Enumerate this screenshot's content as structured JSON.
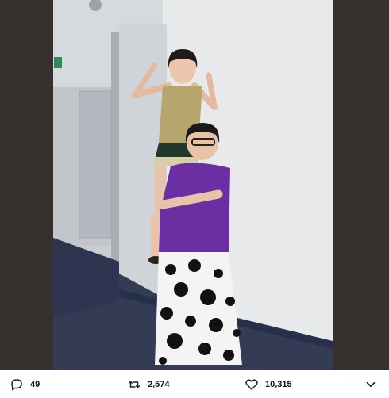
{
  "tweet": {
    "photo_alt": "",
    "actions": {
      "reply": {
        "icon": "reply-icon",
        "count": "49"
      },
      "retweet": {
        "icon": "retweet-icon",
        "count": "2,574"
      },
      "like": {
        "icon": "heart-icon",
        "count": "10,315"
      },
      "share": {
        "icon": "share-icon"
      }
    },
    "colors": {
      "icon_gray": "#657786",
      "text_dark": "#14171a",
      "media_border": "#36302e"
    }
  }
}
